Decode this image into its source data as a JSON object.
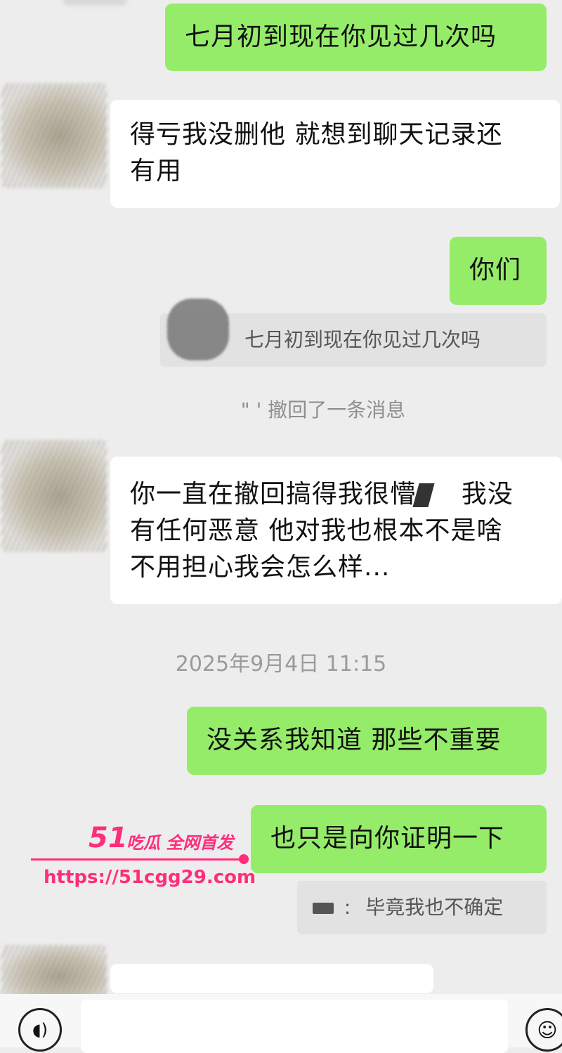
{
  "messages": {
    "m1": "七月初到现在你见过几次吗",
    "m2_line1": "得亏我没删他  就想到聊天记录还",
    "m2_line2": "有用",
    "m3": "你们",
    "quote1": "七月初到现在你见过几次吗",
    "recall_notice": "撤回了一条消息",
    "recall_prefix": "\"   '",
    "m4_line1": "你一直在撤回搞得我很懵",
    "m4_line1b": "我没",
    "m4_line2": "有任何恶意    他对我也根本不是啥",
    "m4_line3": "不用担心我会怎么样...",
    "timestamp": "2025年9月4日 11:15",
    "m5": "没关系我知道 那些不重要",
    "m6": "也只是向你证明一下",
    "quote2_sep": ":",
    "quote2_text": "毕竟我也不确定"
  },
  "watermark": {
    "brand_num": "51",
    "brand_text": "吃瓜 全网首发",
    "url": "https://51cgg29.com"
  },
  "icons": {
    "voice": "voice-icon",
    "emoji": "emoji-icon"
  },
  "colors": {
    "background": "#ededed",
    "sent_bubble": "#95ec69",
    "received_bubble": "#ffffff",
    "watermark": "#ff2d7a"
  }
}
